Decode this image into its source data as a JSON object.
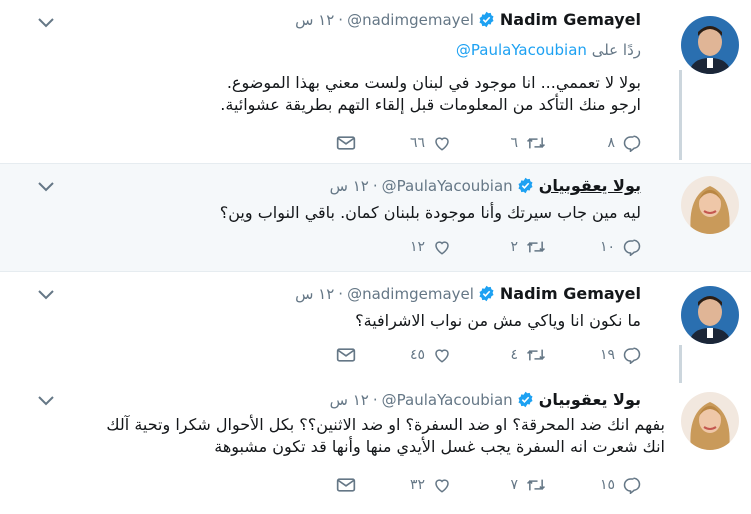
{
  "tweets": [
    {
      "name": "Nadim Gemayel",
      "handle": "@nadimgemayel",
      "time": "١٢ س",
      "reply_prefix": "ردًا على",
      "reply_handle": "@PaulaYacoubian",
      "lines": [
        "بولا لا تعممي... انا موجود في لبنان ولست معني بهذا الموضوع.",
        "ارجو منك التأكد من المعلومات قبل إلقاء التهم بطريقة عشوائية."
      ],
      "replies": "٨",
      "retweets": "٦",
      "likes": "٦٦"
    },
    {
      "name": "بولا يعقوبيان",
      "handle": "@PaulaYacoubian",
      "time": "١٢ س",
      "lines": [
        "ليه مين جاب سيرتك وأنا موجودة بلبنان كمان. باقي النواب وين؟"
      ],
      "replies": "١٠",
      "retweets": "٢",
      "likes": "١٢"
    },
    {
      "name": "Nadim Gemayel",
      "handle": "@nadimgemayel",
      "time": "١٢ س",
      "lines": [
        "ما نكون انا وياكي مش من نواب الاشرافية؟"
      ],
      "replies": "١٩",
      "retweets": "٤",
      "likes": "٤٥"
    },
    {
      "name": "بولا يعقوبيان",
      "handle": "@PaulaYacoubian",
      "time": "١٢ س",
      "lines": [
        "بفهم انك ضد المحرقة؟ او ضد السفرة؟ او ضد الاثنين؟؟ بكل الأحوال شكرا وتحية آلك",
        "انك شعرت انه السفرة يجب غسل الأيدي منها وأنها قد تكون مشبوهة"
      ],
      "replies": "١٥",
      "retweets": "٧",
      "likes": "٣٢"
    }
  ],
  "colors": {
    "accent": "#1da1f2",
    "secondary": "#657786",
    "thread_line": "#ccd6dd",
    "highlight_bg": "#f5f8fa"
  },
  "icons": {
    "verified": "verified-badge-icon",
    "reply": "reply-icon",
    "retweet": "retweet-icon",
    "like": "heart-icon",
    "dm": "envelope-icon",
    "more": "chevron-down-icon"
  }
}
